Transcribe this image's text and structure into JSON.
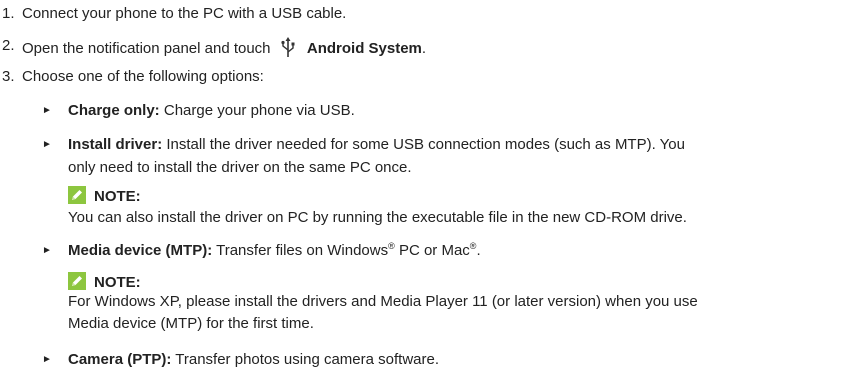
{
  "steps": [
    {
      "num": "1.",
      "text": "Connect your phone to the PC with a USB cable."
    },
    {
      "num": "2.",
      "text_before": "Open the notification panel and touch",
      "bold": "Android System",
      "after": "."
    },
    {
      "num": "3.",
      "text": "Choose one of the following options:"
    }
  ],
  "usb_icon": "usb-icon",
  "options": [
    {
      "bold": "Charge only:",
      "text": "Charge your phone via USB."
    },
    {
      "bold": "Install driver:",
      "text": "Install the driver needed for some USB connection modes (such as MTP). You",
      "text2": "only need to install the driver on the same PC once."
    },
    {
      "bold": "Media device (MTP):",
      "text_a": "Transfer files on Windows",
      "reg1": "®",
      "text_b": "PC or Mac",
      "reg2": "®",
      "text_c": "."
    },
    {
      "bold": "Camera (PTP):",
      "text": "Transfer photos using camera software."
    }
  ],
  "notes": [
    {
      "label": "NOTE:",
      "text": "You can also install the driver on PC by running the executable file in the new CD-ROM drive."
    },
    {
      "label": "NOTE:",
      "text": "For Windows XP, please install the drivers and Media Player 11 (or later version) when you use",
      "text2": "Media device (MTP) for the first time."
    }
  ],
  "colors": {
    "note_icon": "#8dc63f",
    "text": "#222222"
  }
}
